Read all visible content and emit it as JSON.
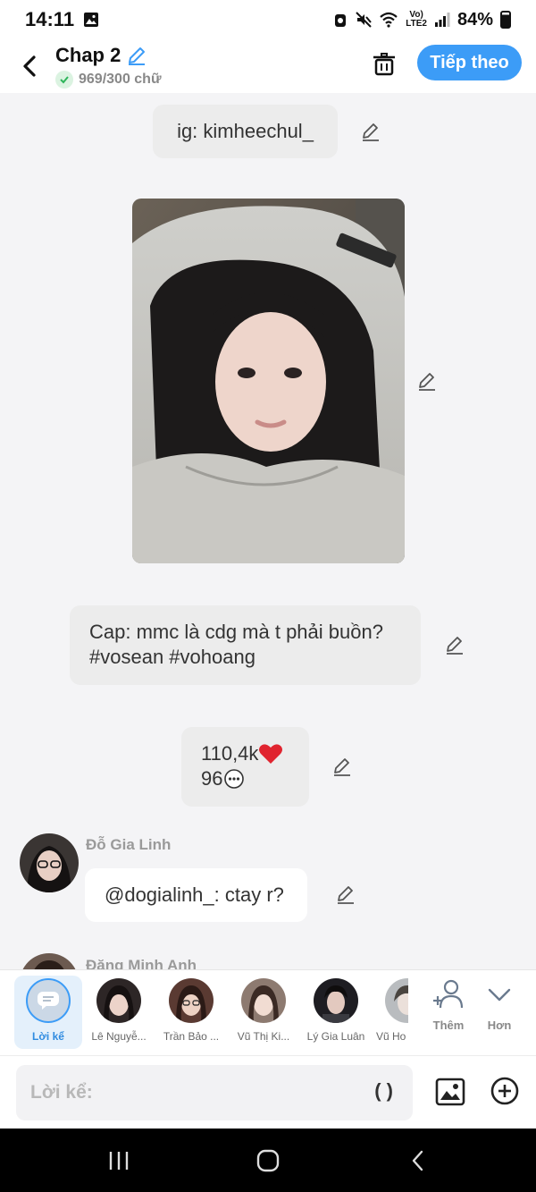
{
  "status_bar": {
    "time": "14:11",
    "network_label_top": "Vo)",
    "network_label_bottom": "LTE2",
    "battery": "84%"
  },
  "header": {
    "title": "Chap 2",
    "word_count": "969/300 chữ",
    "next_button": "Tiếp theo"
  },
  "messages": [
    {
      "type": "narration",
      "text": "ig: kimheechul_"
    },
    {
      "type": "image"
    },
    {
      "type": "narration",
      "text_line1": "Cap: mmc là cdg mà t phải buồn?",
      "text_line2": "#vosean #vohoang"
    },
    {
      "type": "narration",
      "likes": "110,4k",
      "comments": "96"
    },
    {
      "type": "character",
      "sender": "Đỗ Gia Linh",
      "text": "@dogialinh_: ctay r?"
    },
    {
      "type": "character",
      "sender": "Đặng Minh Anh"
    }
  ],
  "characters": [
    {
      "label": "Lời kể",
      "active": true
    },
    {
      "label": "Lê Nguyễ..."
    },
    {
      "label": "Trần Bảo ..."
    },
    {
      "label": "Vũ Thị Ki..."
    },
    {
      "label": "Lý Gia Luân"
    },
    {
      "label": "Vũ Ho"
    }
  ],
  "tools": {
    "add_label": "Thêm",
    "more_label": "Hơn"
  },
  "composer": {
    "placeholder": "Lời kể:",
    "paren": "( )"
  },
  "colors": {
    "accent": "#3c9cf7",
    "bubble": "#ececec",
    "background": "#f4f4f6",
    "heart": "#e0242f"
  }
}
